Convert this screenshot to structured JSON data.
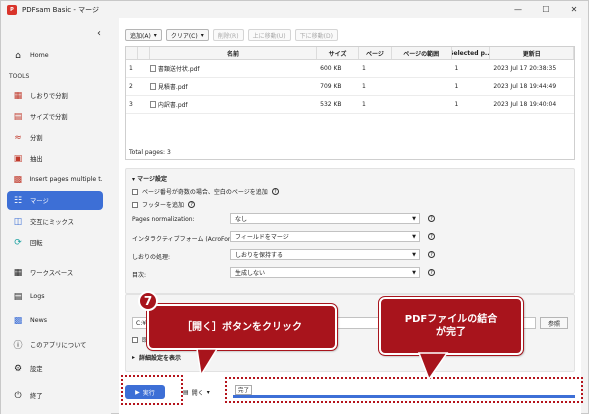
{
  "window": {
    "title": "PDFsam Basic - マージ",
    "app_icon": "pdfsam-logo-icon"
  },
  "sidebar": {
    "collapse_icon": "chevron-left-icon",
    "home": "Home",
    "tools_heading": "TOOLS",
    "tools": [
      {
        "label": "しおりで分割",
        "icon": "bookmark-split-icon"
      },
      {
        "label": "サイズで分割",
        "icon": "size-split-icon"
      },
      {
        "label": "分割",
        "icon": "split-icon"
      },
      {
        "label": "抽出",
        "icon": "extract-icon"
      },
      {
        "label": "Insert pages multiple t...",
        "icon": "insert-pages-icon"
      },
      {
        "label": "マージ",
        "icon": "merge-icon",
        "active": true
      },
      {
        "label": "交互にミックス",
        "icon": "mix-icon"
      },
      {
        "label": "回転",
        "icon": "rotate-icon"
      }
    ],
    "bottom": [
      {
        "label": "ワークスペース",
        "icon": "workspace-icon"
      },
      {
        "label": "Logs",
        "icon": "logs-icon"
      },
      {
        "label": "News",
        "icon": "news-icon"
      },
      {
        "label": "このアプリについて",
        "icon": "info-icon"
      },
      {
        "label": "設定",
        "icon": "settings-icon"
      },
      {
        "label": "終了",
        "icon": "power-icon"
      }
    ]
  },
  "toolbar": {
    "add": "追加(A)",
    "clear": "クリア(C)",
    "remove": "削除(R)",
    "move_up": "上に移動(U)",
    "move_down": "下に移動(D)"
  },
  "table": {
    "headers": [
      "",
      "名前",
      "サイズ",
      "ページ",
      "ページの範囲",
      "Selected p...",
      "更新日"
    ],
    "rows": [
      {
        "num": "1",
        "name": "書類送付状.pdf",
        "size": "600 KB",
        "pages": "1",
        "range": "",
        "selected": "1",
        "modified": "2023 Jul 17 20:38:35"
      },
      {
        "num": "2",
        "name": "見積書.pdf",
        "size": "709 KB",
        "pages": "1",
        "range": "",
        "selected": "1",
        "modified": "2023 Jul 18 19:44:49"
      },
      {
        "num": "3",
        "name": "内訳書.pdf",
        "size": "532 KB",
        "pages": "1",
        "range": "",
        "selected": "1",
        "modified": "2023 Jul 18 19:40:04"
      }
    ]
  },
  "total_pages": "Total pages: 3",
  "merge_settings": {
    "title": "マージ設定",
    "checkbox1": "ページ番号が奇数の場合、空白のページを追加",
    "checkbox2": "フッターを追加",
    "fields": [
      {
        "label": "Pages normalization:",
        "value": "なし"
      },
      {
        "label": "インタラクティブフォーム (AcroForms):",
        "value": "フィールドをマージ"
      },
      {
        "label": "しおりの処理:",
        "value": "しおりを保持する"
      },
      {
        "label": "目次:",
        "value": "生成しない"
      }
    ]
  },
  "destination": {
    "input_value": "C:¥Te",
    "browse": "参照",
    "overwrite_partial": "既存",
    "advanced": "詳細設定を表示"
  },
  "bottom_bar": {
    "run": "実行",
    "open": "開く",
    "status": "完了",
    "progress": 1.0,
    "accent": "#3d6fd6"
  },
  "annotations": {
    "step_number": "7",
    "callout1": "［開く］ボタンをクリック",
    "callout2_line1": "PDFファイルの結合",
    "callout2_line2": "が完了",
    "color": "#a8141c"
  }
}
